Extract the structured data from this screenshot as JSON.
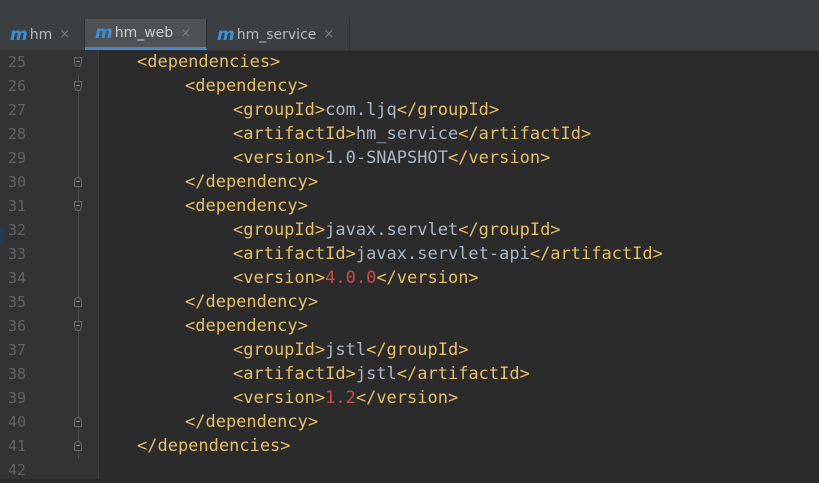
{
  "tabs": [
    {
      "label": "hm",
      "icon": "maven-m-icon"
    },
    {
      "label": "hm_web",
      "icon": "maven-m-icon",
      "active": true
    },
    {
      "label": "hm_service",
      "icon": "maven-m-icon"
    }
  ],
  "tab_icon_glyph": "m",
  "close_glyph": "×",
  "colors": {
    "tag": "#e8bf6a",
    "text": "#a9b7c6",
    "number": "#cc4a4a",
    "background": "#2b2b2b"
  },
  "lines": [
    {
      "n": "25",
      "indent": 1,
      "fold": "open",
      "parts": [
        {
          "t": "<dependencies>",
          "c": "tag"
        }
      ]
    },
    {
      "n": "26",
      "indent": 2,
      "fold": "open",
      "parts": [
        {
          "t": "<dependency>",
          "c": "tag"
        }
      ]
    },
    {
      "n": "27",
      "indent": 3,
      "parts": [
        {
          "t": "<groupId>",
          "c": "tag"
        },
        {
          "t": "com.ljq",
          "c": "txt"
        },
        {
          "t": "</groupId>",
          "c": "tag"
        }
      ]
    },
    {
      "n": "28",
      "indent": 3,
      "parts": [
        {
          "t": "<artifactId>",
          "c": "tag"
        },
        {
          "t": "hm_service",
          "c": "txt"
        },
        {
          "t": "</artifactId>",
          "c": "tag"
        }
      ]
    },
    {
      "n": "29",
      "indent": 3,
      "parts": [
        {
          "t": "<version>",
          "c": "tag"
        },
        {
          "t": "1.0-SNAPSHOT",
          "c": "txt"
        },
        {
          "t": "</version>",
          "c": "tag"
        }
      ]
    },
    {
      "n": "30",
      "indent": 2,
      "fold": "close",
      "parts": [
        {
          "t": "</dependency>",
          "c": "tag"
        }
      ]
    },
    {
      "n": "31",
      "indent": 2,
      "fold": "open",
      "parts": [
        {
          "t": "<dependency>",
          "c": "tag"
        }
      ]
    },
    {
      "n": "32",
      "indent": 3,
      "parts": [
        {
          "t": "<groupId>",
          "c": "tag"
        },
        {
          "t": "javax.servlet",
          "c": "txt"
        },
        {
          "t": "</groupId>",
          "c": "tag"
        }
      ]
    },
    {
      "n": "33",
      "indent": 3,
      "parts": [
        {
          "t": "<artifactId>",
          "c": "tag"
        },
        {
          "t": "javax.servlet-api",
          "c": "txt"
        },
        {
          "t": "</artifactId>",
          "c": "tag"
        }
      ]
    },
    {
      "n": "34",
      "indent": 3,
      "parts": [
        {
          "t": "<version>",
          "c": "tag"
        },
        {
          "t": "4.0.0",
          "c": "num"
        },
        {
          "t": "</version>",
          "c": "tag"
        }
      ]
    },
    {
      "n": "35",
      "indent": 2,
      "fold": "close",
      "parts": [
        {
          "t": "</dependency>",
          "c": "tag"
        }
      ]
    },
    {
      "n": "36",
      "indent": 2,
      "fold": "open",
      "parts": [
        {
          "t": "<dependency>",
          "c": "tag"
        }
      ]
    },
    {
      "n": "37",
      "indent": 3,
      "parts": [
        {
          "t": "<groupId>",
          "c": "tag"
        },
        {
          "t": "jstl",
          "c": "txt"
        },
        {
          "t": "</groupId>",
          "c": "tag"
        }
      ]
    },
    {
      "n": "38",
      "indent": 3,
      "parts": [
        {
          "t": "<artifactId>",
          "c": "tag"
        },
        {
          "t": "jstl",
          "c": "txt"
        },
        {
          "t": "</artifactId>",
          "c": "tag"
        }
      ]
    },
    {
      "n": "39",
      "indent": 3,
      "parts": [
        {
          "t": "<version>",
          "c": "tag"
        },
        {
          "t": "1.2",
          "c": "num"
        },
        {
          "t": "</version>",
          "c": "tag"
        }
      ]
    },
    {
      "n": "40",
      "indent": 2,
      "fold": "close",
      "parts": [
        {
          "t": "</dependency>",
          "c": "tag"
        }
      ]
    },
    {
      "n": "41",
      "indent": 1,
      "fold": "close",
      "parts": [
        {
          "t": "</dependencies>",
          "c": "tag"
        }
      ]
    },
    {
      "n": "42",
      "indent": 0,
      "parts": []
    }
  ]
}
